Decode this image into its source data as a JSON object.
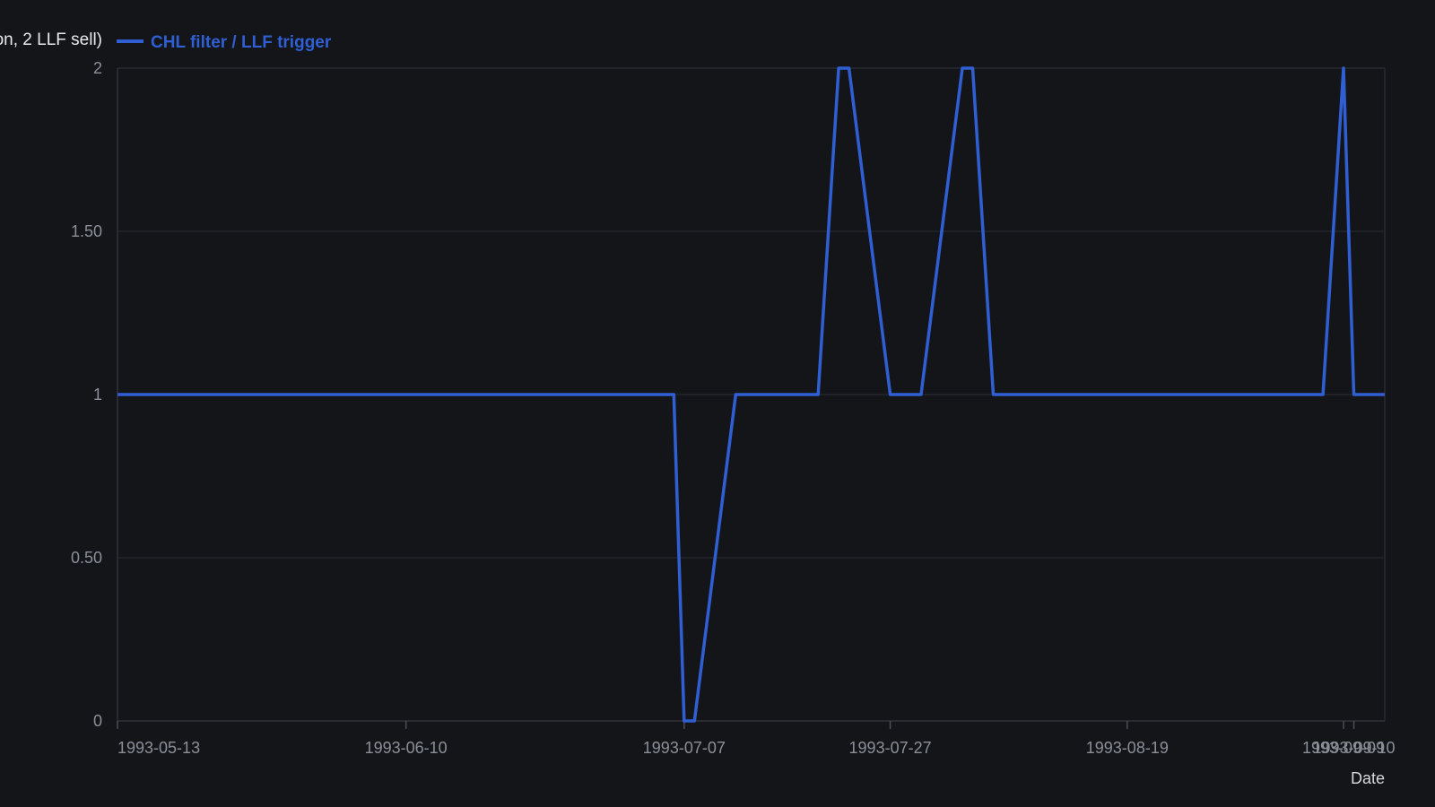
{
  "chart_data": {
    "type": "line",
    "xlabel": "Date",
    "ylabel_partial": "on, 2 LLF sell)",
    "ylim": [
      0,
      2
    ],
    "xlim": [
      "1993-05-13",
      "1993-09-13"
    ],
    "yticks": [
      {
        "value": 0,
        "label": "0"
      },
      {
        "value": 0.5,
        "label": "0.50"
      },
      {
        "value": 1,
        "label": "1"
      },
      {
        "value": 1.5,
        "label": "1.50"
      },
      {
        "value": 2,
        "label": "2"
      }
    ],
    "xticks": [
      "1993-05-13",
      "1993-06-10",
      "1993-07-07",
      "1993-07-27",
      "1993-08-19",
      "1993-09-09",
      "1993-09-10"
    ],
    "grid": true,
    "legend_position": "top-left",
    "series": [
      {
        "name": "CHL filter / LLF trigger",
        "color": "#2f5fd3",
        "x": [
          "1993-05-13",
          "1993-07-06",
          "1993-07-07",
          "1993-07-08",
          "1993-07-12",
          "1993-07-20",
          "1993-07-22",
          "1993-07-23",
          "1993-07-27",
          "1993-07-30",
          "1993-08-03",
          "1993-08-04",
          "1993-08-06",
          "1993-09-07",
          "1993-09-09",
          "1993-09-10",
          "1993-09-13"
        ],
        "values": [
          1,
          1,
          0,
          0,
          1,
          1,
          2,
          2,
          1,
          1,
          2,
          2,
          1,
          1,
          2,
          1,
          1
        ]
      }
    ]
  }
}
